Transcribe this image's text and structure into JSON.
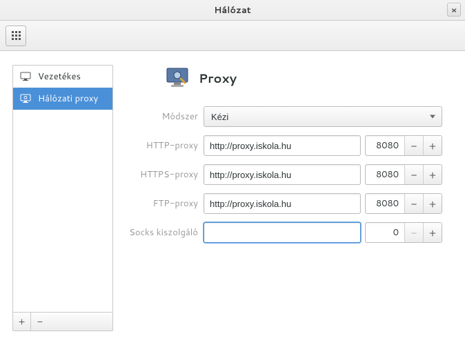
{
  "window": {
    "title": "Hálózat"
  },
  "sidebar": {
    "items": [
      {
        "label": "Vezetékes",
        "selected": false
      },
      {
        "label": "Hálózati proxy",
        "selected": true
      }
    ]
  },
  "main": {
    "heading": "Proxy",
    "labels": {
      "method": "Módszer",
      "http": "HTTP-proxy",
      "https": "HTTPS-proxy",
      "ftp": "FTP-proxy",
      "socks": "Socks kiszolgáló"
    },
    "method": {
      "value": "Kézi"
    },
    "http": {
      "host": "http://proxy.iskola.hu",
      "port": "8080"
    },
    "https": {
      "host": "http://proxy.iskola.hu",
      "port": "8080"
    },
    "ftp": {
      "host": "http://proxy.iskola.hu",
      "port": "8080"
    },
    "socks": {
      "host": "",
      "port": "0"
    }
  },
  "glyphs": {
    "minus": "−",
    "plus": "+",
    "close": "×"
  }
}
